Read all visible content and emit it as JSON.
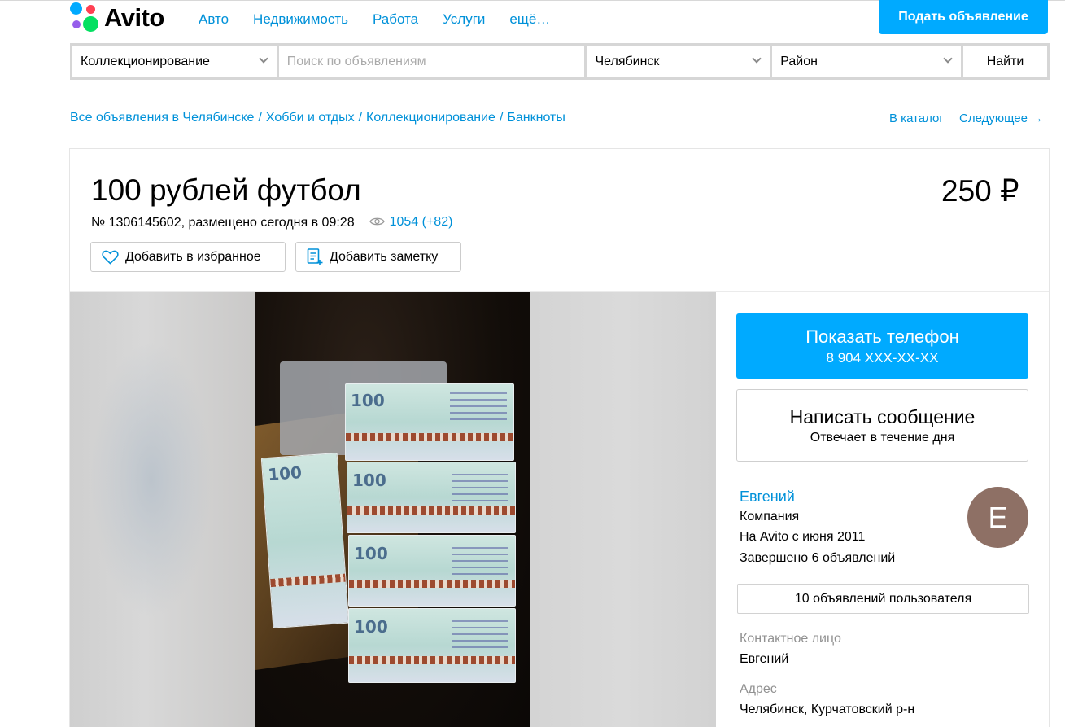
{
  "header": {
    "logo_text": "Avito",
    "nav": [
      "Авто",
      "Недвижимость",
      "Работа",
      "Услуги",
      "ещё…"
    ],
    "post_button": "Подать объявление"
  },
  "search": {
    "category": "Коллекционирование",
    "placeholder": "Поиск по объявлениям",
    "city": "Челябинск",
    "district": "Район",
    "find_button": "Найти"
  },
  "breadcrumbs": {
    "items": [
      "Все объявления в Челябинске",
      "Хобби и отдых",
      "Коллекционирование",
      "Банкноты"
    ],
    "separator": "/",
    "catalog_link": "В каталог",
    "next_link": "Следующее →"
  },
  "listing": {
    "title": "100 рублей футбол",
    "price": "250 ₽",
    "meta": "№ 1306145602, размещено сегодня в 09:28",
    "views": "1054 (+82)",
    "favorite_button": "Добавить в избранное",
    "note_button": "Добавить заметку"
  },
  "sidebar": {
    "phone_button": "Показать телефон",
    "phone_number": "8 904 XXX-XX-XX",
    "message_button": "Написать сообщение",
    "message_sub": "Отвечает в течение дня",
    "seller_name": "Евгений",
    "seller_type": "Компания",
    "seller_since": "На Avito с июня 2011",
    "seller_completed": "Завершено 6 объявлений",
    "avatar_letter": "E",
    "ads_button": "10 объявлений пользователя",
    "contact_label": "Контактное лицо",
    "contact_value": "Евгений",
    "address_label": "Адрес",
    "address_value": "Челябинск, Курчатовский р-н"
  },
  "colors": {
    "brand_blue": "#00aaff",
    "link_blue": "#0091d9",
    "avatar_bg": "#8e7065"
  },
  "icons": [
    "heart-icon",
    "note-icon",
    "eye-icon",
    "chevron-down-icon"
  ]
}
